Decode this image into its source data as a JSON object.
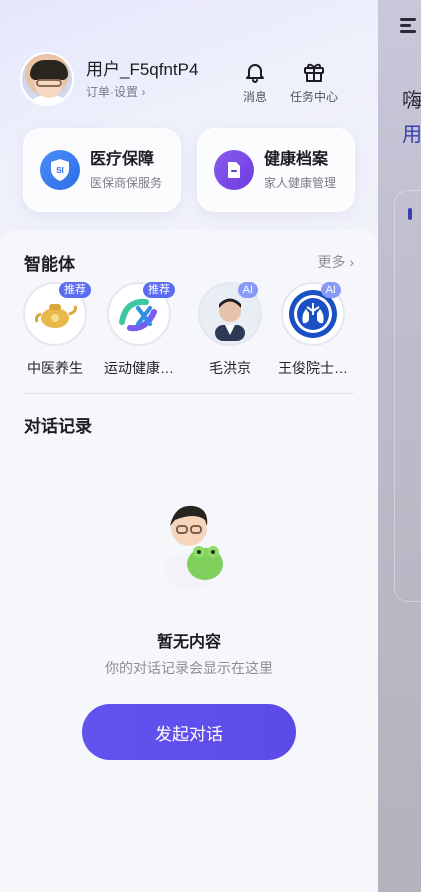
{
  "user": {
    "name": "用户_F5qfntP4",
    "sub_link": "订单·设置 ›"
  },
  "header_actions": {
    "messages_label": "消息",
    "tasks_label": "任务中心"
  },
  "services": [
    {
      "title": "医疗保障",
      "subtitle": "医保商保服务",
      "icon": "si-shield-icon",
      "icon_text": "SI"
    },
    {
      "title": "健康档案",
      "subtitle": "家人健康管理",
      "icon": "health-record-icon"
    }
  ],
  "agents_section": {
    "title": "智能体",
    "more": "更多 ›",
    "items": [
      {
        "name": "中医养生",
        "badge": "推荐"
      },
      {
        "name": "运动健康…",
        "badge": "推荐"
      },
      {
        "name": "毛洪京",
        "badge": "AI"
      },
      {
        "name": "王俊院士…",
        "badge": "AI"
      }
    ]
  },
  "history_section": {
    "title": "对话记录",
    "empty_title": "暂无内容",
    "empty_subtitle": "你的对话记录会显示在这里",
    "start_button": "发起对话"
  },
  "background_app": {
    "line1": "嗨",
    "line2": "用"
  },
  "colors": {
    "accent": "#5b4ae8",
    "badge": "#5b6cf3"
  }
}
